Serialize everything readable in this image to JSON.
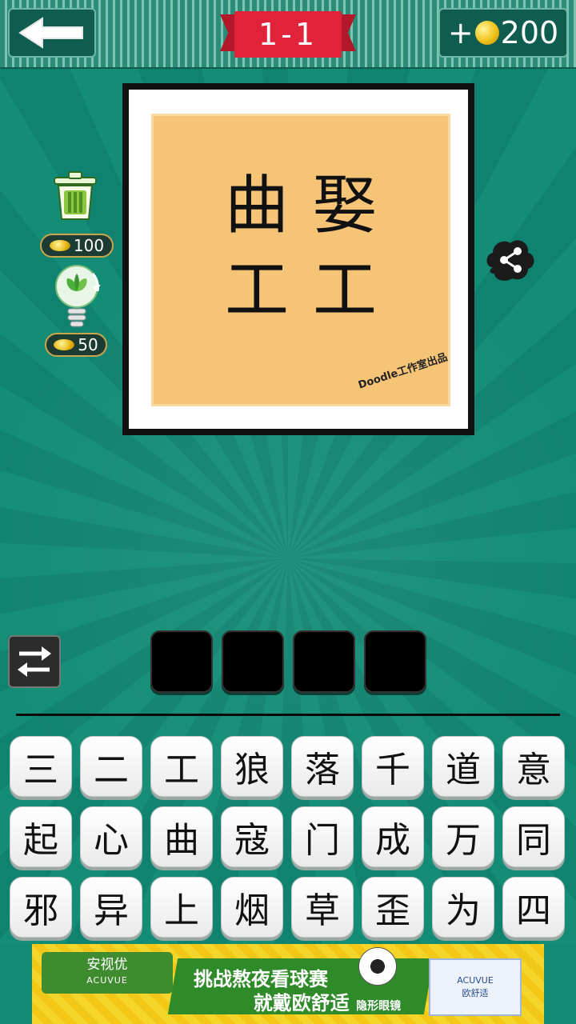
{
  "header": {
    "back_icon": "left-arrow-icon",
    "level": "1-1",
    "coins_prefix": "+",
    "coins": "200"
  },
  "puzzle": {
    "clue_row1": [
      "曲",
      "娶"
    ],
    "clue_row2": [
      "工",
      "工"
    ],
    "credit": "Doodle工作室出品"
  },
  "tools": {
    "remove_icon": "trash-icon",
    "remove_cost": "100",
    "hint_icon": "lightbulb-icon",
    "hint_cost": "50",
    "share_icon": "share-icon",
    "shuffle_icon": "shuffle-arrows-icon"
  },
  "answer": {
    "slots": [
      "",
      "",
      "",
      ""
    ]
  },
  "keyboard": {
    "keys": [
      "三",
      "二",
      "工",
      "狼",
      "落",
      "千",
      "道",
      "意",
      "起",
      "心",
      "曲",
      "寇",
      "门",
      "成",
      "万",
      "同",
      "邪",
      "异",
      "上",
      "烟",
      "草",
      "歪",
      "为",
      "四"
    ]
  },
  "ad": {
    "brand_name": "安视优",
    "brand_sub": "ACUVUE",
    "slogan_line1": "挑战熬夜看球赛",
    "slogan_line2": "就戴欧舒适",
    "slogan_small": "隐形眼镜",
    "product_brand": "ACUVUE",
    "product_name": "欧舒适"
  },
  "colors": {
    "background": "#138a74",
    "ribbon": "#e0233a",
    "coin": "#f2c21a",
    "ad_yellow": "#f6d52a",
    "ad_green": "#2f8a2a"
  }
}
